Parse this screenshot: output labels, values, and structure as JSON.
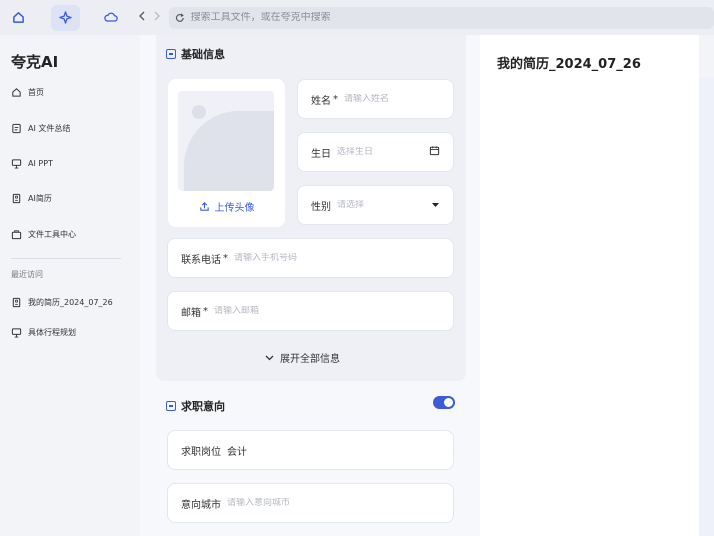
{
  "topbar": {
    "address_placeholder": "搜索工具文件，或在夸克中搜索",
    "icons": [
      "home-icon",
      "sparkle-icon",
      "cloud-icon"
    ]
  },
  "sidebar": {
    "brand": "夸克AI",
    "items": [
      {
        "label": "首页",
        "icon": "home-icon"
      },
      {
        "label": "AI 文件总结",
        "icon": "document-icon"
      },
      {
        "label": "AI PPT",
        "icon": "presentation-icon"
      },
      {
        "label": "AI简历",
        "icon": "resume-icon"
      },
      {
        "label": "文件工具中心",
        "icon": "toolbox-icon"
      }
    ],
    "section_title": "最近访问",
    "recent": [
      {
        "label": "我的简历_2024_07_26",
        "icon": "resume-icon"
      },
      {
        "label": "具体行程规划",
        "icon": "presentation-icon"
      }
    ]
  },
  "form": {
    "basic_title": "基础信息",
    "upload_label": "上传头像",
    "name": {
      "label": "姓名",
      "required": "*",
      "placeholder": "请输入姓名"
    },
    "birthday": {
      "label": "生日",
      "placeholder": "选择生日"
    },
    "gender": {
      "label": "性别",
      "placeholder": "请选择"
    },
    "phone": {
      "label": "联系电话",
      "required": "*",
      "placeholder": "请输入手机号码"
    },
    "email": {
      "label": "邮箱",
      "required": "*",
      "placeholder": "请输入邮箱"
    },
    "expand_label": "展开全部信息",
    "intent_title": "求职意向",
    "intent_enabled": true,
    "position": {
      "label": "求职岗位",
      "value": "会计"
    },
    "city": {
      "label": "意向城市",
      "placeholder": "请输入意向城市"
    }
  },
  "preview": {
    "title": "我的简历_2024_07_26"
  },
  "colors": {
    "accent": "#3b5bdb"
  }
}
